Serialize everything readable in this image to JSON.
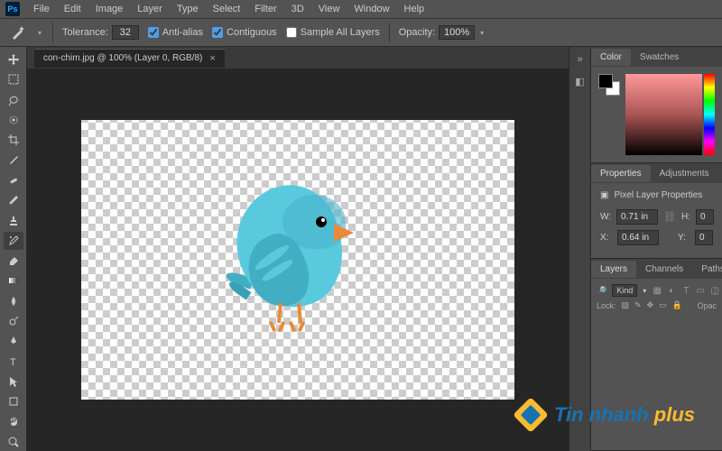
{
  "menu": [
    "File",
    "Edit",
    "Image",
    "Layer",
    "Type",
    "Select",
    "Filter",
    "3D",
    "View",
    "Window",
    "Help"
  ],
  "options": {
    "tolerance_label": "Tolerance:",
    "tolerance_value": "32",
    "anti_alias": "Anti-alias",
    "contiguous": "Contiguous",
    "sample_all": "Sample All Layers",
    "opacity_label": "Opacity:",
    "opacity_value": "100%"
  },
  "doc_tab": "con-chim.jpg @ 100% (Layer 0, RGB/8)",
  "panels": {
    "color_tab": "Color",
    "swatches_tab": "Swatches",
    "properties_tab": "Properties",
    "adjustments_tab": "Adjustments",
    "pixel_layer_title": "Pixel Layer Properties",
    "w_label": "W:",
    "w_value": "0.71 in",
    "h_label": "H:",
    "h_value": "0",
    "x_label": "X:",
    "x_value": "0.64 in",
    "y_label": "Y:",
    "y_value": "0",
    "layers_tab": "Layers",
    "channels_tab": "Channels",
    "paths_tab": "Paths",
    "kind_label": "Kind",
    "lock_label": "Lock:",
    "opac_label": "Opac"
  },
  "watermark": {
    "brand": "Tin nhanh",
    "suffix": "plus"
  }
}
